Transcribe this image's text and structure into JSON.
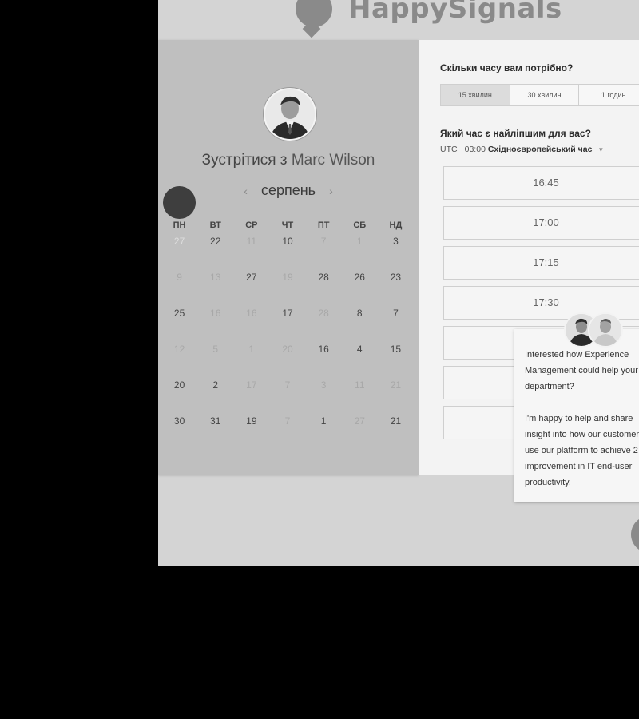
{
  "header": {
    "logo_text": "HappySignals"
  },
  "meeting": {
    "title_prefix": "Зустрітися з",
    "host_name": "Marc Wilson"
  },
  "calendar": {
    "month": "серпень",
    "prev_icon": "chevron-left-icon",
    "next_icon": "chevron-right-icon",
    "weekdays": [
      "ПН",
      "ВТ",
      "СР",
      "ЧТ",
      "ПТ",
      "СБ",
      "НД"
    ],
    "selected_day": "27",
    "rows": [
      [
        {
          "d": "27",
          "s": "sel"
        },
        {
          "d": "22"
        },
        {
          "d": "11",
          "s": "dim"
        },
        {
          "d": "10"
        },
        {
          "d": "7",
          "s": "dim"
        },
        {
          "d": "1",
          "s": "dim"
        },
        {
          "d": "3"
        }
      ],
      [
        {
          "d": "9",
          "s": "dim"
        },
        {
          "d": "13",
          "s": "dim"
        },
        {
          "d": "27"
        },
        {
          "d": "19",
          "s": "dim"
        },
        {
          "d": "28"
        },
        {
          "d": "26"
        },
        {
          "d": "23"
        }
      ],
      [
        {
          "d": "25"
        },
        {
          "d": "16",
          "s": "dim"
        },
        {
          "d": "16",
          "s": "dim"
        },
        {
          "d": "17"
        },
        {
          "d": "28",
          "s": "dim"
        },
        {
          "d": "8"
        },
        {
          "d": "7"
        }
      ],
      [
        {
          "d": "12",
          "s": "dim"
        },
        {
          "d": "5",
          "s": "dim"
        },
        {
          "d": "1",
          "s": "dim"
        },
        {
          "d": "20",
          "s": "dim"
        },
        {
          "d": "16"
        },
        {
          "d": "4"
        },
        {
          "d": "15"
        }
      ],
      [
        {
          "d": "20"
        },
        {
          "d": "2"
        },
        {
          "d": "17",
          "s": "dim"
        },
        {
          "d": "7",
          "s": "dim"
        },
        {
          "d": "3",
          "s": "dim"
        },
        {
          "d": "11",
          "s": "dim"
        },
        {
          "d": "21",
          "s": "dim"
        }
      ],
      [
        {
          "d": "30"
        },
        {
          "d": "31"
        },
        {
          "d": "19"
        },
        {
          "d": "7",
          "s": "dim"
        },
        {
          "d": "1"
        },
        {
          "d": "27",
          "s": "dim"
        },
        {
          "d": "21"
        }
      ]
    ]
  },
  "booking": {
    "duration_question": "Скільки часу вам потрібно?",
    "durations": [
      "15 хвилин",
      "30 хвилин",
      "1 годин"
    ],
    "active_duration": "15 хвилин",
    "time_question": "Який час є найліпшим для вас?",
    "timezone_offset": "UTC +03:00",
    "timezone_name": "Східноєвропейський час",
    "dropdown_icon": "caret-down-icon",
    "slots": [
      "16:45",
      "17:00",
      "17:15",
      "17:30",
      "",
      "",
      ""
    ]
  },
  "chat": {
    "message": "Interested how Experience Management could help your department?\n\nI'm happy to help and share insight into how our customers use our platform to achieve 2 improvement in IT end-user productivity.",
    "launcher_icon": "chat-icon"
  }
}
